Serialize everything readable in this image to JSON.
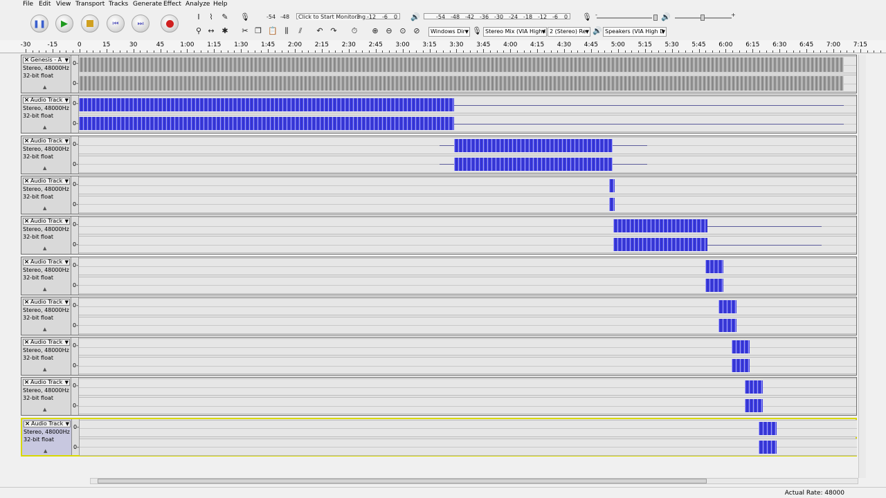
{
  "menu": [
    "File",
    "Edit",
    "View",
    "Transport",
    "Tracks",
    "Generate",
    "Effect",
    "Analyze",
    "Help"
  ],
  "transport": {
    "pause_icon": "pause-icon",
    "play_icon": "play-icon",
    "stop_icon": "stop-icon",
    "skip_start_icon": "skip-to-start-icon",
    "skip_end_icon": "skip-to-end-icon",
    "record_icon": "record-icon"
  },
  "meters": {
    "record_scale": [
      "-54",
      "-48"
    ],
    "record_prompt": "Click to Start Monitoring",
    "record_scale_right": [
      "3",
      "-12",
      "-6",
      "0"
    ],
    "playback_scale": [
      "-54",
      "-48",
      "-42",
      "-36",
      "-30",
      "-24",
      "-18",
      "-12",
      "-6",
      "0"
    ],
    "plus": "+",
    "minus": "-"
  },
  "devices": {
    "host": "Windows Dir",
    "recording_device": "Stereo Mix (VIA High I",
    "channels": "2 (Stereo) Re",
    "playback_device": "Speakers (VIA High D"
  },
  "ruler_ticks": [
    "-30",
    "-15",
    "0",
    "15",
    "30",
    "45",
    "1:00",
    "1:15",
    "1:30",
    "1:45",
    "2:00",
    "2:15",
    "2:30",
    "2:45",
    "3:00",
    "3:15",
    "3:30",
    "3:45",
    "4:00",
    "4:15",
    "4:30",
    "4:45",
    "5:00",
    "5:15",
    "5:30",
    "5:45",
    "6:00",
    "6:15",
    "6:30",
    "6:45",
    "7:00",
    "7:15"
  ],
  "tracks": [
    {
      "name": "Genesis - A",
      "format": "Stereo, 48000Hz",
      "depth": "32-bit float",
      "vlabel": "0-",
      "color": "gray"
    },
    {
      "name": "Audio Track",
      "format": "Stereo, 48000Hz",
      "depth": "32-bit float",
      "vlabel": "0-",
      "color": "blue"
    },
    {
      "name": "Audio Track",
      "format": "Stereo, 48000Hz",
      "depth": "32-bit float",
      "vlabel": "0-",
      "color": "blue"
    },
    {
      "name": "Audio Track",
      "format": "Stereo, 48000Hz",
      "depth": "32-bit float",
      "vlabel": "0-",
      "color": "blue"
    },
    {
      "name": "Audio Track",
      "format": "Stereo, 48000Hz",
      "depth": "32-bit float",
      "vlabel": "0-",
      "color": "blue"
    },
    {
      "name": "Audio Track",
      "format": "Stereo, 48000Hz",
      "depth": "32-bit float",
      "vlabel": "0-",
      "color": "blue"
    },
    {
      "name": "Audio Track",
      "format": "Stereo, 48000Hz",
      "depth": "32-bit float",
      "vlabel": "0-",
      "color": "blue"
    },
    {
      "name": "Audio Track",
      "format": "Stereo, 48000Hz",
      "depth": "32-bit float",
      "vlabel": "0-",
      "color": "blue"
    },
    {
      "name": "Audio Track",
      "format": "Stereo, 48000Hz",
      "depth": "32-bit float",
      "vlabel": "0-",
      "color": "blue"
    },
    {
      "name": "Audio Track",
      "format": "Stereo, 48000Hz",
      "depth": "32-bit float",
      "vlabel": "0-",
      "color": "blue",
      "selected": true
    }
  ],
  "status": {
    "rate": "Actual Rate: 48000"
  },
  "colors": {
    "waveform_blue": "#3d3de2",
    "waveform_gray": "#a0a0a0",
    "selected_border": "#d8d800"
  }
}
